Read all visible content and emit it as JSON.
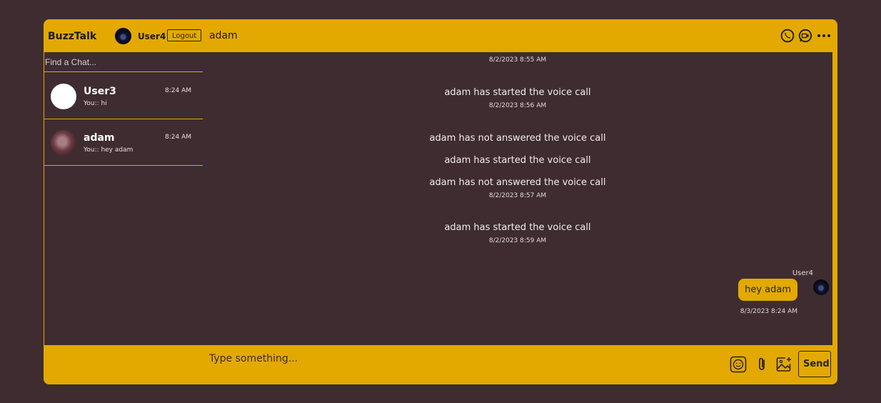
{
  "app": {
    "name": "BuzzTalk",
    "current_user": "User4",
    "logout_label": "Logout",
    "active_chat": "adam",
    "accent_color": "#e3a901",
    "background_color": "#3e2c31"
  },
  "header_icons": [
    "phone-icon",
    "video-call-icon",
    "more-icon"
  ],
  "sidebar": {
    "search_placeholder": "Find a Chat...",
    "chats": [
      {
        "name": "User3",
        "preview": "You:: hi",
        "time": "8:24 AM"
      },
      {
        "name": "adam",
        "preview": "You:: hey adam",
        "time": "8:24 AM"
      }
    ]
  },
  "messages": {
    "items": [
      {
        "timestamp": "8/2/2023 8:55 AM"
      },
      {
        "text": "adam has started the voice call",
        "timestamp": "8/2/2023 8:56 AM"
      },
      {
        "text": "adam has not answered the voice call"
      },
      {
        "text": "adam has started the voice call"
      },
      {
        "text": "adam has not answered the voice call",
        "timestamp": "8/2/2023 8:57 AM"
      },
      {
        "text": "adam has started the voice call",
        "timestamp": "8/2/2023 8:59 AM"
      }
    ],
    "own_message": {
      "sender": "User4",
      "text": "hey adam",
      "timestamp": "8/3/2023 8:24 AM"
    }
  },
  "composer": {
    "placeholder": "Type something...",
    "send_label": "Send",
    "icons": [
      "emoji-icon",
      "attachment-icon",
      "add-image-icon"
    ]
  }
}
